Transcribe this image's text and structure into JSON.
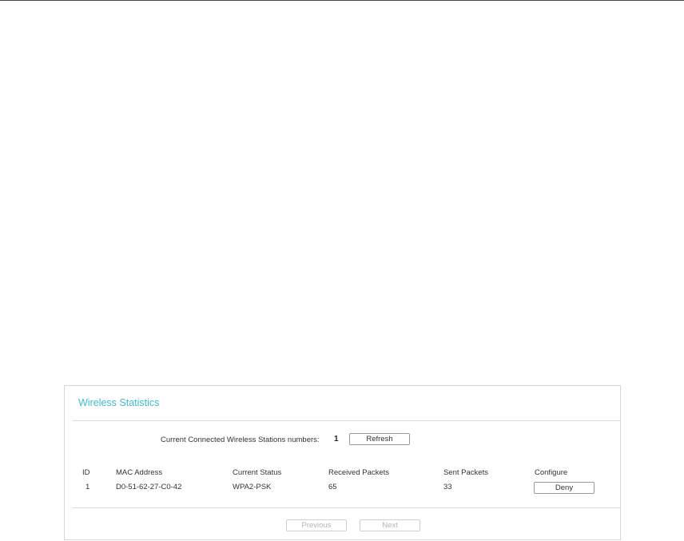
{
  "panel": {
    "title": "Wireless Statistics"
  },
  "stations": {
    "label": "Current Connected Wireless Stations numbers:",
    "count": "1",
    "refresh_label": "Refresh"
  },
  "table": {
    "headers": {
      "id": "ID",
      "mac": "MAC Address",
      "status": "Current Status",
      "received": "Received Packets",
      "sent": "Sent Packets",
      "configure": "Configure"
    },
    "rows": [
      {
        "id": "1",
        "mac": "D0-51-62-27-C0-42",
        "status": "WPA2-PSK",
        "received": "65",
        "sent": "33",
        "action_label": "Deny"
      }
    ]
  },
  "pagination": {
    "previous_label": "Previous",
    "next_label": "Next"
  },
  "colors": {
    "title_accent": "#3fb9d3",
    "border": "#d6d6d6",
    "disabled_text": "#b5b5b5"
  }
}
